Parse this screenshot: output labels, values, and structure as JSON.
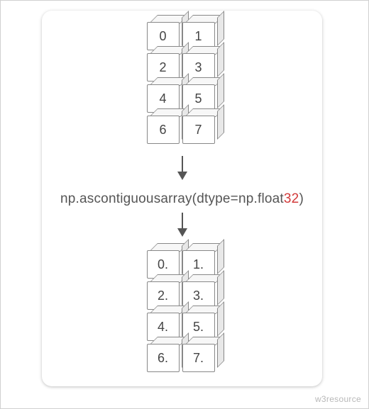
{
  "diagram": {
    "top_array": [
      "0",
      "1",
      "2",
      "3",
      "4",
      "5",
      "6",
      "7"
    ],
    "bottom_array": [
      "0.",
      "1.",
      "2.",
      "3.",
      "4.",
      "5.",
      "6.",
      "7."
    ],
    "code_prefix": "np.ascontiguousarray(dtype=np.float",
    "code_accent": "32",
    "code_suffix": ")"
  },
  "footer": {
    "watermark": "w3resource"
  }
}
